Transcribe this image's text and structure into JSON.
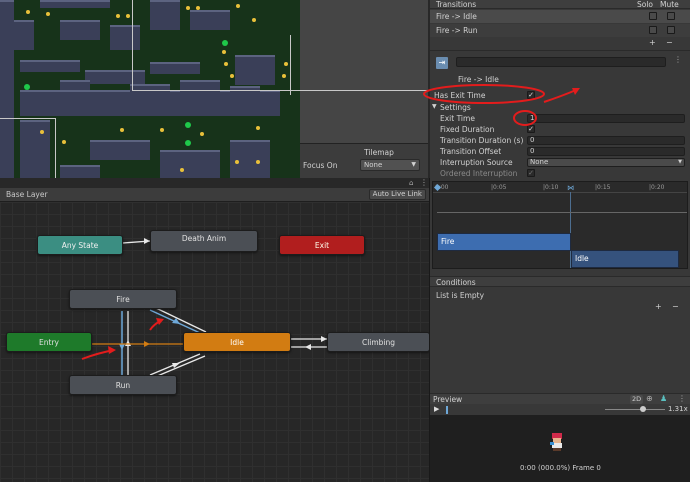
{
  "scene": {
    "tilemap_overlay": {
      "title": "Tilemap",
      "focus_label": "Focus On",
      "focus_value": "None"
    }
  },
  "animator": {
    "layer": "Base Layer",
    "auto_live_link": "Auto Live Link",
    "states": {
      "any_state": "Any State",
      "death_anim": "Death Anim",
      "exit": "Exit",
      "fire": "Fire",
      "entry": "Entry",
      "idle": "Idle",
      "climbing": "Climbing",
      "run": "Run"
    },
    "colors": {
      "default_state": "#d27c12",
      "entry": "#1e7a2a",
      "any_state": "#3b8e82",
      "exit": "#b11e1e",
      "selected_transition": "#6ea8d8",
      "annotation": "#e31c1c"
    }
  },
  "inspector": {
    "transitions_header": "Transitions",
    "solo_label": "Solo",
    "mute_label": "Mute",
    "transitions": [
      {
        "name": "Fire -> Idle"
      },
      {
        "name": "Fire -> Run"
      }
    ],
    "add_btn": "+",
    "remove_btn": "−",
    "transition_title": "Fire -> Idle",
    "has_exit_time_label": "Has Exit Time",
    "has_exit_time_value": "✓",
    "settings_label": "Settings",
    "exit_time_label": "Exit Time",
    "exit_time_value": "1",
    "fixed_duration_label": "Fixed Duration",
    "fixed_duration_value": "✓",
    "transition_duration_label": "Transition Duration (s)",
    "transition_duration_value": "0",
    "transition_offset_label": "Transition Offset",
    "transition_offset_value": "0",
    "interruption_source_label": "Interruption Source",
    "interruption_source_value": "None",
    "ordered_interruption_label": "Ordered Interruption",
    "ordered_interruption_value": "✓",
    "timeline": {
      "ticks": [
        "0:00",
        "|0:05",
        "|0:10",
        "|0:15",
        "|0:20"
      ],
      "bar_fire": "Fire",
      "bar_idle": "Idle"
    },
    "conditions_header": "Conditions",
    "conditions_empty": "List is Empty",
    "preview": {
      "title": "Preview",
      "mode": "2D",
      "speed": "1.31x",
      "frame": "0:00 (000.0%) Frame 0"
    }
  }
}
